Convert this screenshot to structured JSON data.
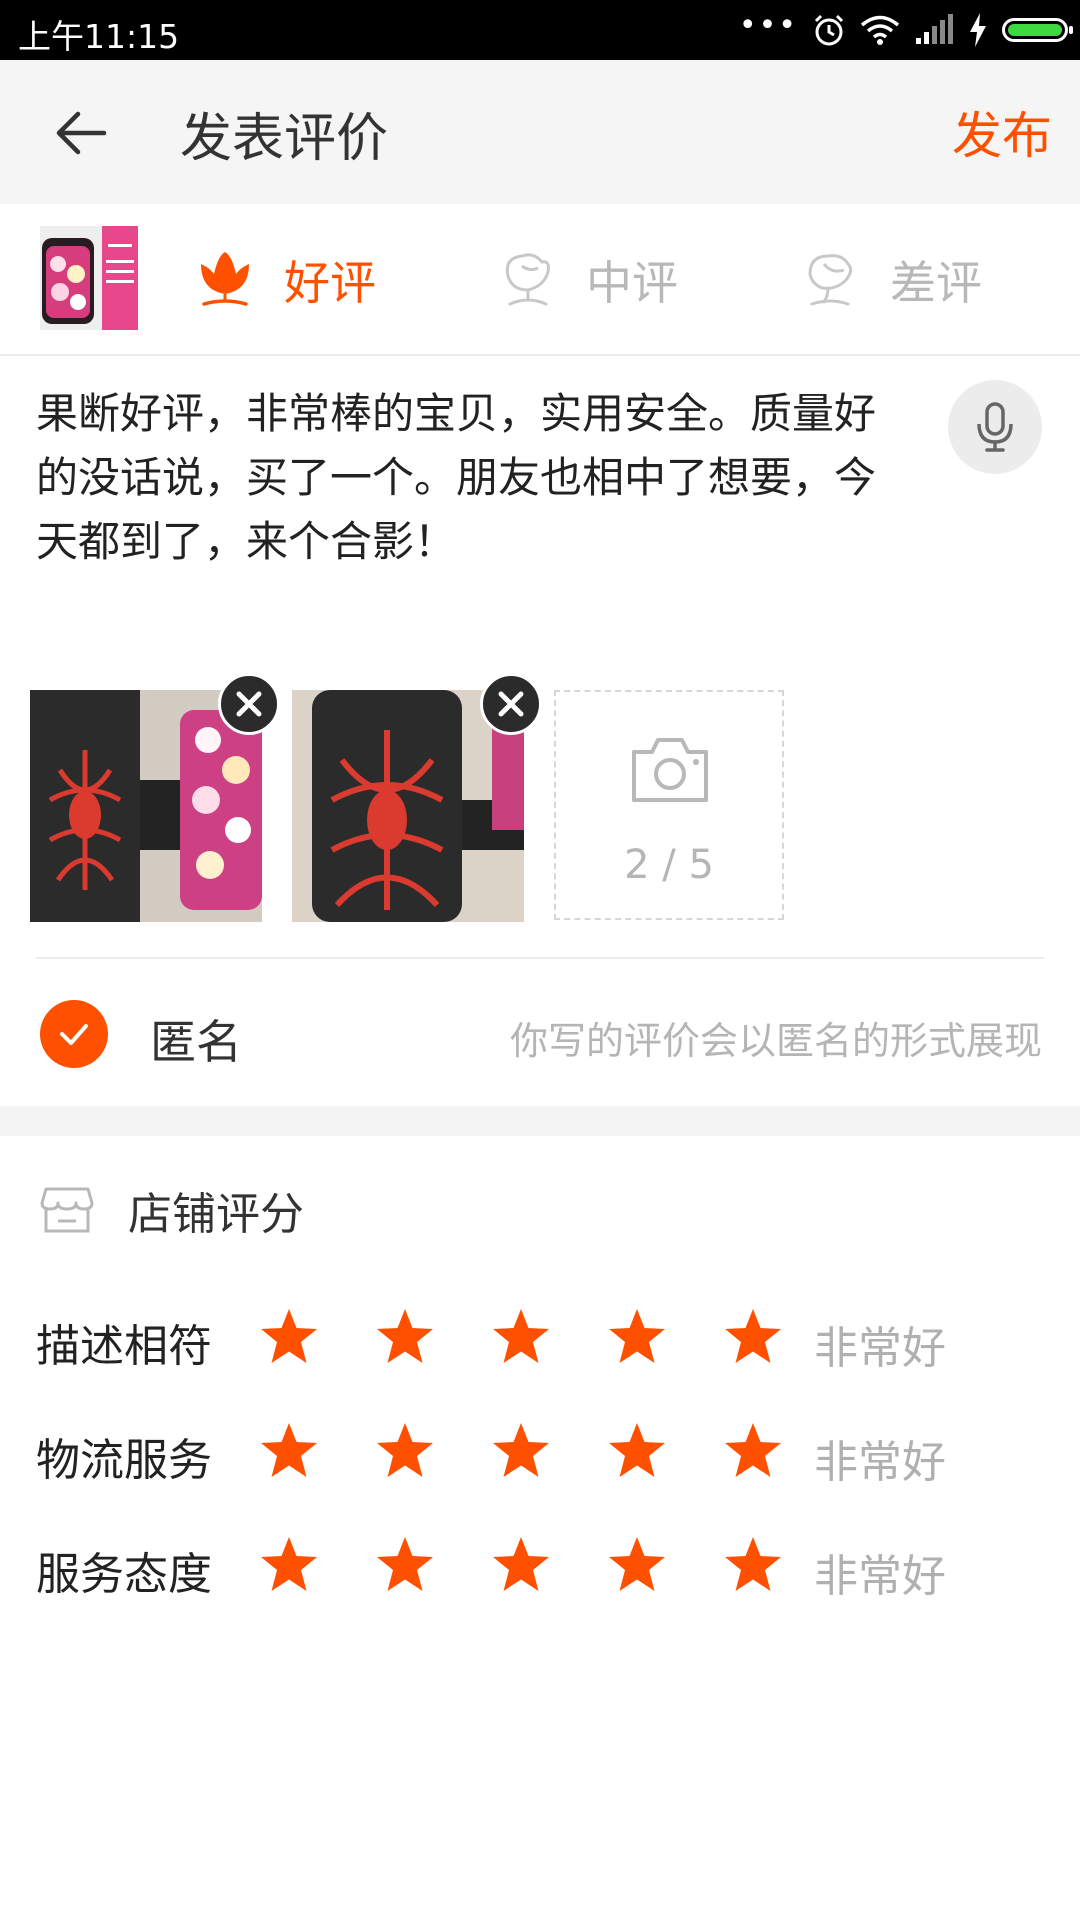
{
  "status_bar": {
    "time": "上午11:15",
    "dots": "•••"
  },
  "header": {
    "title": "发表评价",
    "publish_label": "发布"
  },
  "rating_tabs": [
    {
      "label": "好评",
      "selected": true
    },
    {
      "label": "中评",
      "selected": false
    },
    {
      "label": "差评",
      "selected": false
    }
  ],
  "review": {
    "text": "果断好评，非常棒的宝贝，实用安全。质量好的没话说，买了一个。朋友也相中了想要，今天都到了，来个合影！"
  },
  "photos": {
    "count_label": "2 / 5",
    "uploaded": 2,
    "max": 5
  },
  "anonymous": {
    "label": "匿名",
    "hint": "你写的评价会以匿名的形式展现",
    "checked": true
  },
  "shop_rating": {
    "title": "店铺评分",
    "rows": [
      {
        "name": "描述相符",
        "stars": 5,
        "verdict": "非常好"
      },
      {
        "name": "物流服务",
        "stars": 5,
        "verdict": "非常好"
      },
      {
        "name": "服务态度",
        "stars": 5,
        "verdict": "非常好"
      }
    ]
  },
  "colors": {
    "accent": "#ff5000",
    "inactive": "#b8b8b8",
    "header_bg": "#f5f5f5"
  }
}
